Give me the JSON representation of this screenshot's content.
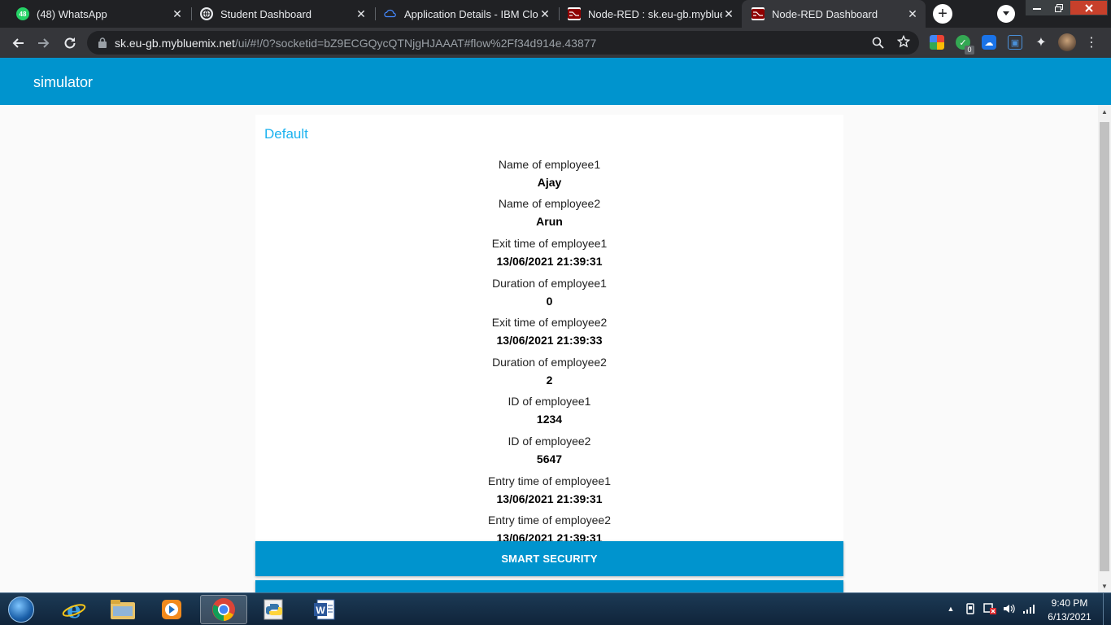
{
  "browser": {
    "tabs": [
      {
        "title": "(48) WhatsApp",
        "icon": "whatsapp-icon",
        "badge": "48",
        "color": "#25d366"
      },
      {
        "title": "Student Dashboard",
        "icon": "globe-icon",
        "color": "#e8eaed"
      },
      {
        "title": "Application Details - IBM Cloud",
        "icon": "ibm-cloud-icon",
        "color": "#4589ff"
      },
      {
        "title": "Node-RED : sk.eu-gb.mybluemix.net",
        "icon": "node-red-icon",
        "color": "#8f0000"
      },
      {
        "title": "Node-RED Dashboard",
        "icon": "node-red-icon",
        "color": "#8f0000"
      }
    ],
    "active_tab": 4,
    "new_tab_label": "+",
    "address": {
      "host": "sk.eu-gb.mybluemix.net",
      "path": "/ui/#!/0?socketid=bZ9ECGQycQTNjgHJAAAT#flow%2Ff34d914e.43877"
    },
    "extension_badge": "0"
  },
  "app": {
    "title": "simulator",
    "group_title": "Default",
    "fields": [
      {
        "label": "Name of employee1",
        "value": "Ajay"
      },
      {
        "label": "Name of employee2",
        "value": "Arun"
      },
      {
        "label": "Exit time of employee1",
        "value": "13/06/2021 21:39:31"
      },
      {
        "label": "Duration of employee1",
        "value": "0"
      },
      {
        "label": "Exit time of employee2",
        "value": "13/06/2021 21:39:33"
      },
      {
        "label": "Duration of employee2",
        "value": "2"
      },
      {
        "label": "ID of employee1",
        "value": "1234"
      },
      {
        "label": "ID of employee2",
        "value": "5647"
      },
      {
        "label": "Entry time of employee1",
        "value": "13/06/2021 21:39:31"
      },
      {
        "label": "Entry time of employee2",
        "value": "13/06/2021 21:39:31"
      }
    ],
    "buttons": [
      {
        "label": "SMART SECURITY"
      },
      {
        "label": ""
      }
    ],
    "colors": {
      "header": "#0094ce",
      "group_title": "#1bb2ef",
      "button": "#0094ce"
    }
  },
  "taskbar": {
    "apps": [
      "internet-explorer-icon",
      "file-explorer-icon",
      "media-player-icon",
      "chrome-icon",
      "python-icon",
      "word-icon"
    ],
    "clock_time": "9:40 PM",
    "clock_date": "6/13/2021"
  }
}
